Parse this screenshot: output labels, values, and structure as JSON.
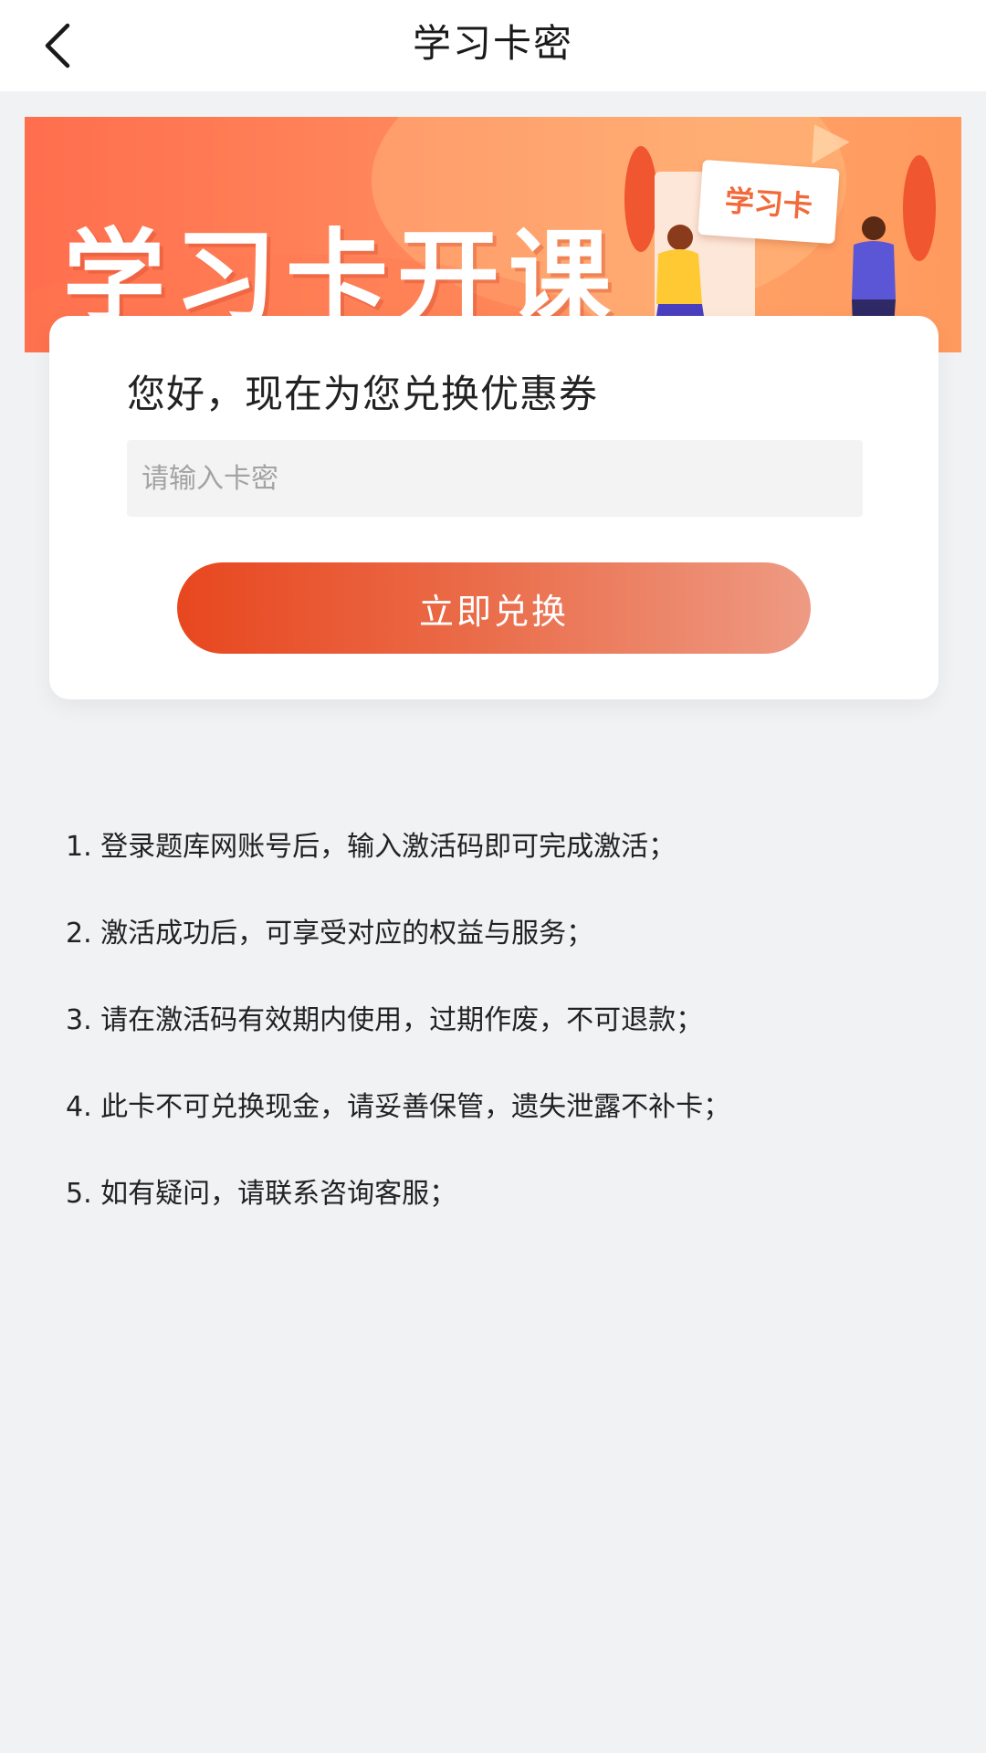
{
  "header": {
    "title": "学习卡密",
    "back_icon": "chevron-left-icon"
  },
  "banner": {
    "headline": "学习卡开课",
    "sign_text": "学习卡"
  },
  "redeem": {
    "greeting": "您好，现在为您兑换优惠券",
    "input_placeholder": "请输入卡密",
    "input_value": "",
    "button_label": "立即兑换"
  },
  "rules": [
    "1. 登录题库网账号后，输入激活码即可完成激活；",
    "2. 激活成功后，可享受对应的权益与服务；",
    "3. 请在激活码有效期内使用，过期作废，不可退款；",
    "4. 此卡不可兑换现金，请妥善保管，遗失泄露不补卡；",
    "5. 如有疑问，请联系咨询客服；"
  ],
  "colors": {
    "accent": "#e8471f",
    "background": "#f1f2f4"
  }
}
